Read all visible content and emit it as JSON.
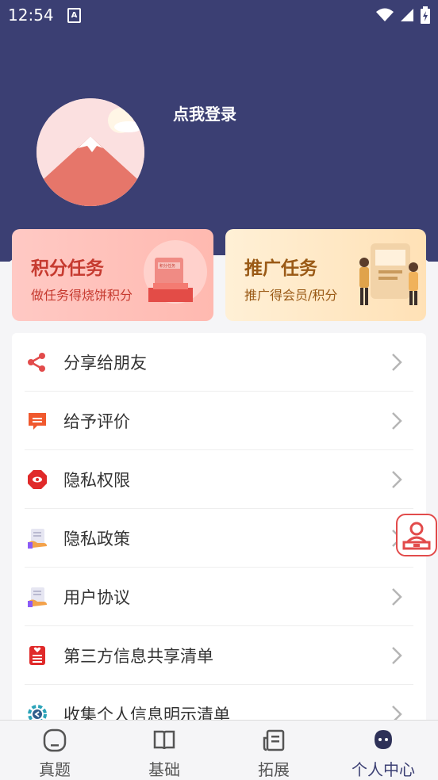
{
  "status_bar": {
    "time": "12:54",
    "notification_icon": "a-icon",
    "icons": [
      "wifi-icon",
      "signal-icon",
      "battery-icon"
    ]
  },
  "profile": {
    "login_text": "点我登录",
    "avatar": "mountain-avatar"
  },
  "tasks": [
    {
      "title": "积分任务",
      "subtitle": "做任务得烧饼积分",
      "art_text": "积分任务"
    },
    {
      "title": "推广任务",
      "subtitle": "推广得会员/积分"
    }
  ],
  "menu": [
    {
      "label": "分享给朋友",
      "icon": "share-icon"
    },
    {
      "label": "给予评价",
      "icon": "comment-icon"
    },
    {
      "label": "隐私权限",
      "icon": "privacy-permission-icon"
    },
    {
      "label": "隐私政策",
      "icon": "privacy-policy-icon"
    },
    {
      "label": "用户协议",
      "icon": "user-agreement-icon"
    },
    {
      "label": "第三方信息共享清单",
      "icon": "third-party-list-icon"
    },
    {
      "label": "收集个人信息明示清单",
      "icon": "collection-list-icon"
    }
  ],
  "floating_button": {
    "icon": "customer-service-icon"
  },
  "tabbar": [
    {
      "label": "真题",
      "icon": "exam-icon",
      "active": false
    },
    {
      "label": "基础",
      "icon": "book-icon",
      "active": false
    },
    {
      "label": "拓展",
      "icon": "document-icon",
      "active": false
    },
    {
      "label": "个人中心",
      "icon": "profile-icon",
      "active": true
    }
  ],
  "colors": {
    "header": "#3b3f73",
    "accent_red": "#e24b4b",
    "card_left": "#ffbcb4",
    "card_right": "#ffe4bd"
  }
}
